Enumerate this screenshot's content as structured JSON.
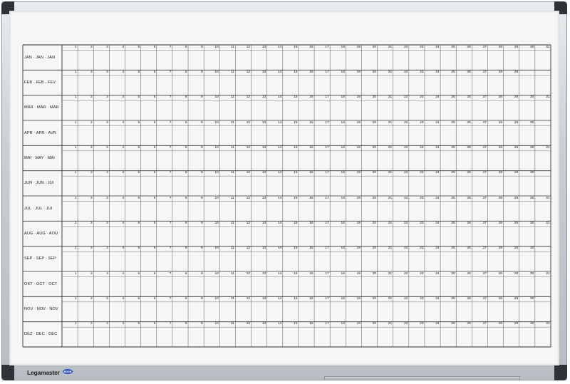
{
  "months": [
    {
      "label": "JAN · JAN · JAN",
      "days": 31
    },
    {
      "label": "FEB · FEB · FEV",
      "days": 29
    },
    {
      "label": "MÄR · MAR · MAR",
      "days": 31
    },
    {
      "label": "APR · APR · AVR",
      "days": 30
    },
    {
      "label": "MAI · MAY · MAI",
      "days": 31
    },
    {
      "label": "JUN · JUN · JUI",
      "days": 30
    },
    {
      "label": "JUL · JUL · JUI",
      "days": 31
    },
    {
      "label": "AUG · AUG · AOU",
      "days": 31
    },
    {
      "label": "SEP · SEP · SEP",
      "days": 30
    },
    {
      "label": "OKT · OCT · OCT",
      "days": 31
    },
    {
      "label": "NOV · NOV · NOV",
      "days": 30
    },
    {
      "label": "DEZ · DEC · DEC",
      "days": 31
    }
  ],
  "brand": {
    "name": "Legamaster",
    "logo_text": "EDGE"
  }
}
